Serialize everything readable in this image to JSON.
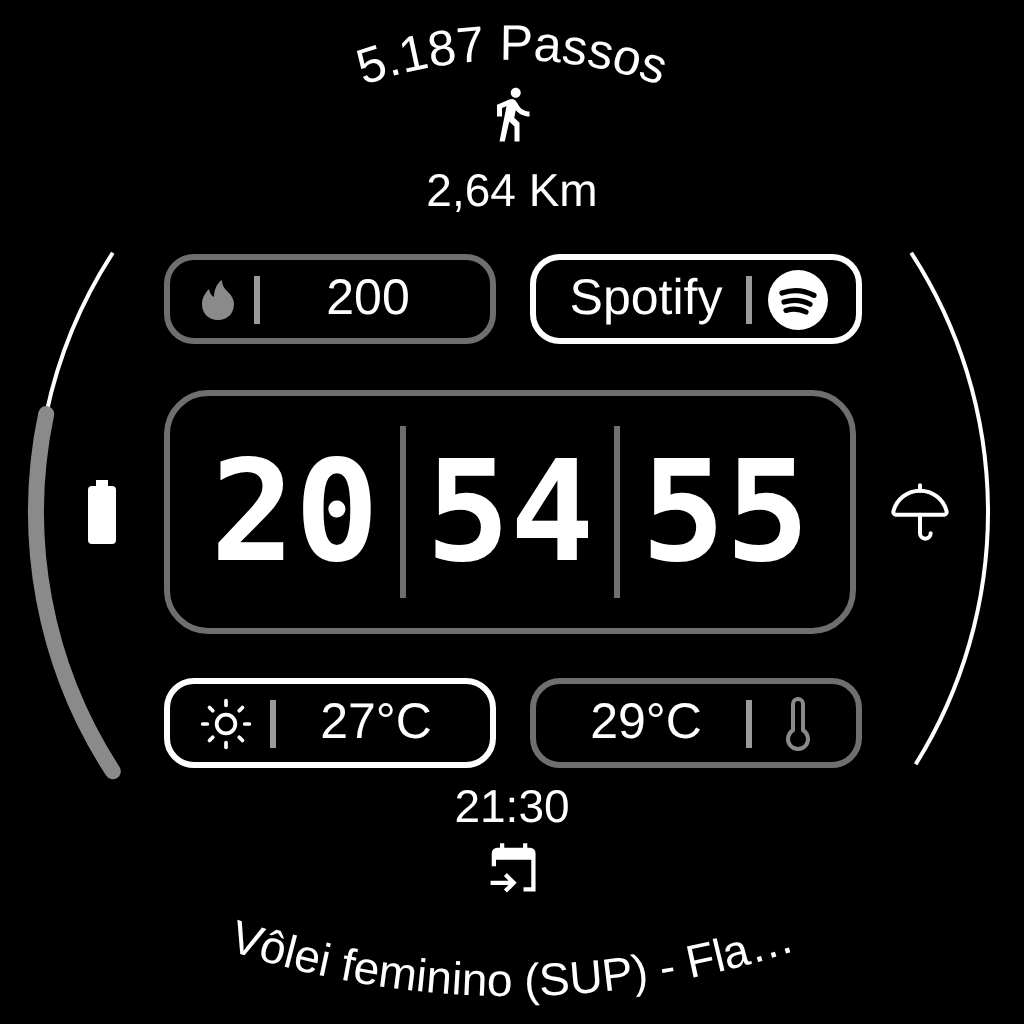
{
  "steps": "5.187 Passos",
  "distance": "2,64 Km",
  "pills_top": [
    {
      "kind": "flame",
      "text": "200",
      "highlighted": false
    },
    {
      "kind": "spotify",
      "text": "Spotify",
      "highlighted": true
    }
  ],
  "time": [
    "20",
    "54",
    "55"
  ],
  "pills_bottom": [
    {
      "kind": "sun",
      "text": "27°C",
      "highlighted": true
    },
    {
      "kind": "thermometer",
      "text": "29°C",
      "highlighted": false
    }
  ],
  "next_event": {
    "time": "21:30",
    "title": "Vôlei feminino (SUP) - Fla…"
  }
}
